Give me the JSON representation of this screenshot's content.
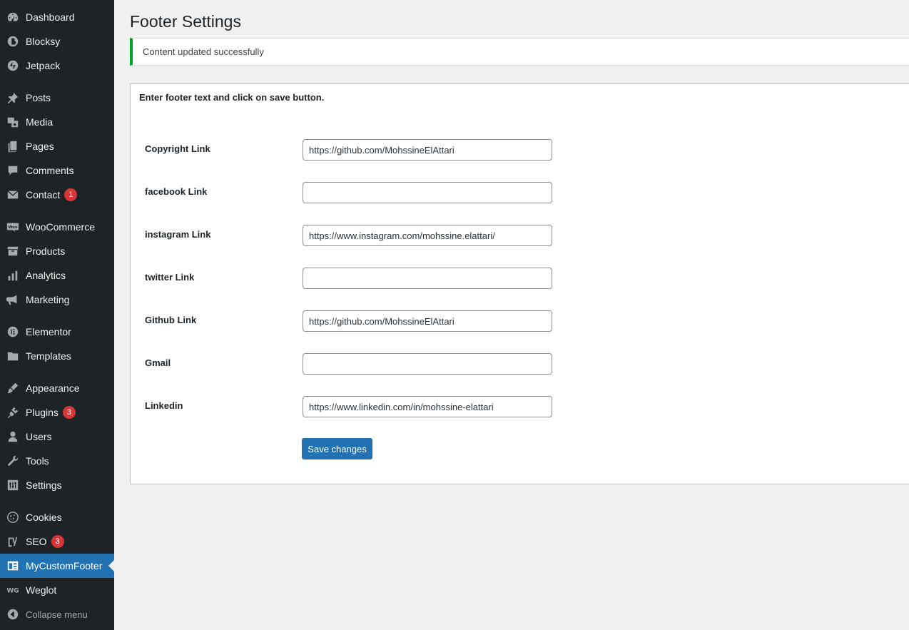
{
  "sidebar": {
    "items": [
      {
        "label": "Dashboard",
        "icon": "dashboard-icon"
      },
      {
        "label": "Blocksy",
        "icon": "blocksy-icon"
      },
      {
        "label": "Jetpack",
        "icon": "jetpack-icon"
      },
      {
        "label": "Posts",
        "icon": "pin-icon"
      },
      {
        "label": "Media",
        "icon": "media-icon"
      },
      {
        "label": "Pages",
        "icon": "pages-icon"
      },
      {
        "label": "Comments",
        "icon": "comment-icon"
      },
      {
        "label": "Contact",
        "icon": "envelope-icon",
        "badge": "1"
      },
      {
        "label": "WooCommerce",
        "icon": "woocommerce-icon"
      },
      {
        "label": "Products",
        "icon": "archive-icon"
      },
      {
        "label": "Analytics",
        "icon": "bar-chart-icon"
      },
      {
        "label": "Marketing",
        "icon": "megaphone-icon"
      },
      {
        "label": "Elementor",
        "icon": "elementor-icon"
      },
      {
        "label": "Templates",
        "icon": "folder-icon"
      },
      {
        "label": "Appearance",
        "icon": "brush-icon"
      },
      {
        "label": "Plugins",
        "icon": "plug-icon",
        "badge": "3"
      },
      {
        "label": "Users",
        "icon": "user-icon"
      },
      {
        "label": "Tools",
        "icon": "wrench-icon"
      },
      {
        "label": "Settings",
        "icon": "sliders-icon"
      },
      {
        "label": "Cookies",
        "icon": "cookie-icon"
      },
      {
        "label": "SEO",
        "icon": "yoast-icon",
        "badge": "3"
      },
      {
        "label": "MyCustomFooter",
        "icon": "layout-icon",
        "current": true
      },
      {
        "label": "Weglot",
        "icon": "weglot-icon"
      }
    ],
    "collapse_label": "Collapse menu"
  },
  "page": {
    "title": "Footer Settings",
    "notice": "Content updated successfully",
    "intro": "Enter footer text and click on save button.",
    "save_label": "Save changes"
  },
  "fields": [
    {
      "label": "Copyright Link",
      "value": "https://github.com/MohssineElAttari"
    },
    {
      "label": "facebook Link",
      "value": ""
    },
    {
      "label": "instagram Link",
      "value": "https://www.instagram.com/mohssine.elattari/"
    },
    {
      "label": "twitter Link",
      "value": ""
    },
    {
      "label": "Github Link",
      "value": "https://github.com/MohssineElAttari"
    },
    {
      "label": "Gmail",
      "value": ""
    },
    {
      "label": "Linkedin",
      "value": "https://www.linkedin.com/in/mohssine-elattari"
    }
  ],
  "colors": {
    "sidebar_bg": "#1d2327",
    "accent": "#2271b1",
    "success": "#00a32a",
    "badge": "#d63638"
  }
}
